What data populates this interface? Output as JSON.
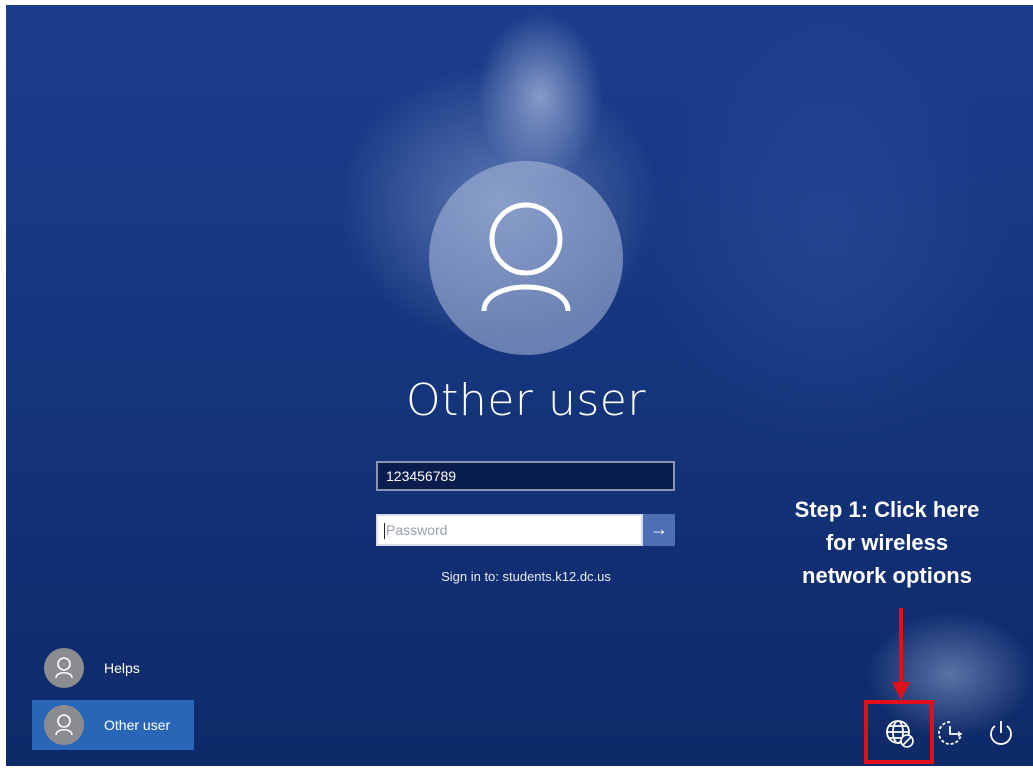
{
  "account": {
    "name": "Other user",
    "username_value": "123456789",
    "password_placeholder": "Password",
    "sign_in_to": "Sign in to: students.k12.dc.us"
  },
  "user_list": [
    {
      "label": "Helps",
      "selected": false
    },
    {
      "label": "Other user",
      "selected": true
    }
  ],
  "annotation": {
    "lines": [
      "Step 1: Click here",
      "for wireless",
      "network options"
    ]
  },
  "system_icons": [
    "network-icon",
    "ease-of-access-icon",
    "power-icon"
  ],
  "colors": {
    "accent": "#2a66b8",
    "highlight": "#e0101a"
  }
}
